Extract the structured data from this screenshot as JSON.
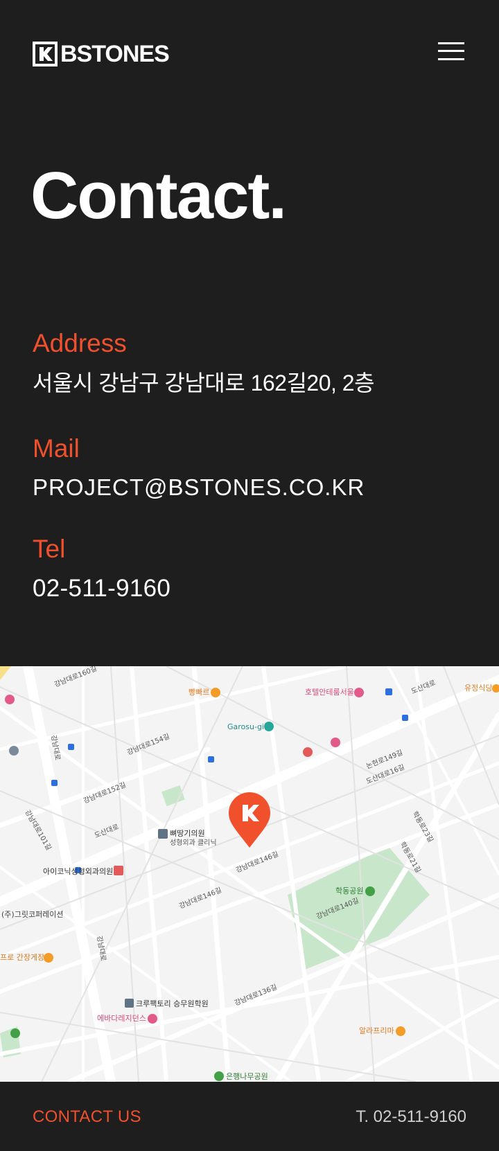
{
  "header": {
    "brand": "BSTONES",
    "menu_icon": "hamburger-menu-icon"
  },
  "page": {
    "title": "Contact."
  },
  "contact": {
    "address_label": "Address",
    "address_value": "서울시 강남구 강남대로 162길20, 2층",
    "mail_label": "Mail",
    "mail_value": "PROJECT@BSTONES.CO.KR",
    "tel_label": "Tel",
    "tel_value": "02-511-9160"
  },
  "map": {
    "marker_icon": "location-pin-icon",
    "pois": {
      "p1": "빵빠르",
      "p2": "호텔안테룸서울",
      "p3": "도산대로",
      "p4": "유정식당",
      "p5": "Garosu-gil",
      "p6": "뼈땅기의원",
      "p7": "성형외과 클리닉",
      "p8": "아이코닉성형외과의원",
      "p9": "학동공원",
      "p10": "(주)그릿코퍼레이션",
      "p11": "프로 간장게장",
      "p12": "크루팩토리 승무원학원",
      "p13": "에바다레지던스",
      "p14": "알라프리마",
      "p15": "은행나무공원"
    },
    "roads": {
      "r1": "강남대로160길",
      "r2": "강남대로154길",
      "r3": "강남대로152길",
      "r4": "도산대로",
      "r5": "논현로149길",
      "r6": "도산대로16길",
      "r7": "강남대로146길",
      "r8": "강남대로140길",
      "r9": "강남대로136길",
      "r10": "학동로23길",
      "r11": "학동로21길",
      "r12": "강남대로101길",
      "r13": "강남대로"
    },
    "colors": {
      "marker": "#f0502c",
      "park": "#c8e6c9",
      "road": "#ffffff",
      "base": "#f4f4f4"
    }
  },
  "footer": {
    "contact_label": "CONTACT US",
    "tel": "T. 02-511-9160"
  },
  "colors": {
    "accent": "#f0502c",
    "background": "#1f1e1e",
    "text": "#ffffff"
  }
}
